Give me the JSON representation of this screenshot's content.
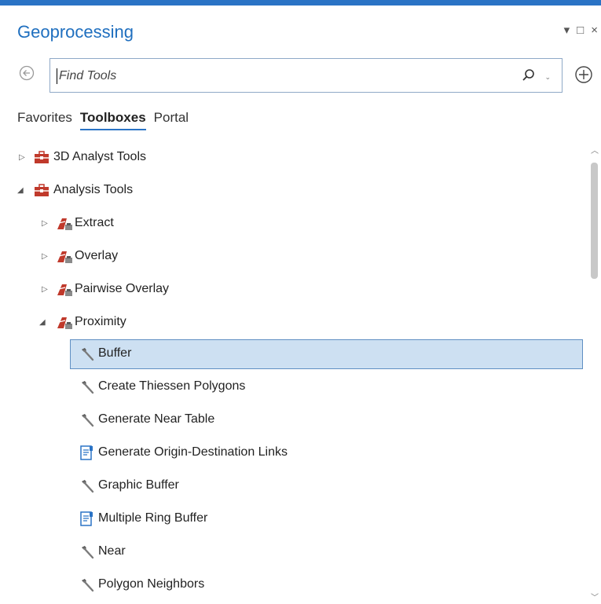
{
  "panel": {
    "title": "Geoprocessing",
    "controls": {
      "pin": "▾",
      "maximize": "□",
      "close": "×"
    }
  },
  "search": {
    "placeholder": "Find Tools",
    "value": ""
  },
  "tabs": [
    {
      "label": "Favorites",
      "active": false
    },
    {
      "label": "Toolboxes",
      "active": true
    },
    {
      "label": "Portal",
      "active": false
    }
  ],
  "tree": [
    {
      "label": "3D Analyst Tools",
      "kind": "toolbox",
      "expanded": false
    },
    {
      "label": "Analysis Tools",
      "kind": "toolbox",
      "expanded": true
    },
    {
      "label": "Extract",
      "kind": "toolset",
      "expanded": false
    },
    {
      "label": "Overlay",
      "kind": "toolset",
      "expanded": false
    },
    {
      "label": "Pairwise Overlay",
      "kind": "toolset",
      "expanded": false
    },
    {
      "label": "Proximity",
      "kind": "toolset",
      "expanded": true
    },
    {
      "label": "Buffer",
      "kind": "tool",
      "selected": true
    },
    {
      "label": "Create Thiessen Polygons",
      "kind": "tool"
    },
    {
      "label": "Generate Near Table",
      "kind": "tool"
    },
    {
      "label": "Generate Origin-Destination Links",
      "kind": "script"
    },
    {
      "label": "Graphic Buffer",
      "kind": "tool"
    },
    {
      "label": "Multiple Ring Buffer",
      "kind": "script"
    },
    {
      "label": "Near",
      "kind": "tool"
    },
    {
      "label": "Polygon Neighbors",
      "kind": "tool"
    }
  ],
  "colors": {
    "accent": "#2a73c5",
    "selection": "#cde0f2",
    "toolbox": "#c0392b"
  }
}
